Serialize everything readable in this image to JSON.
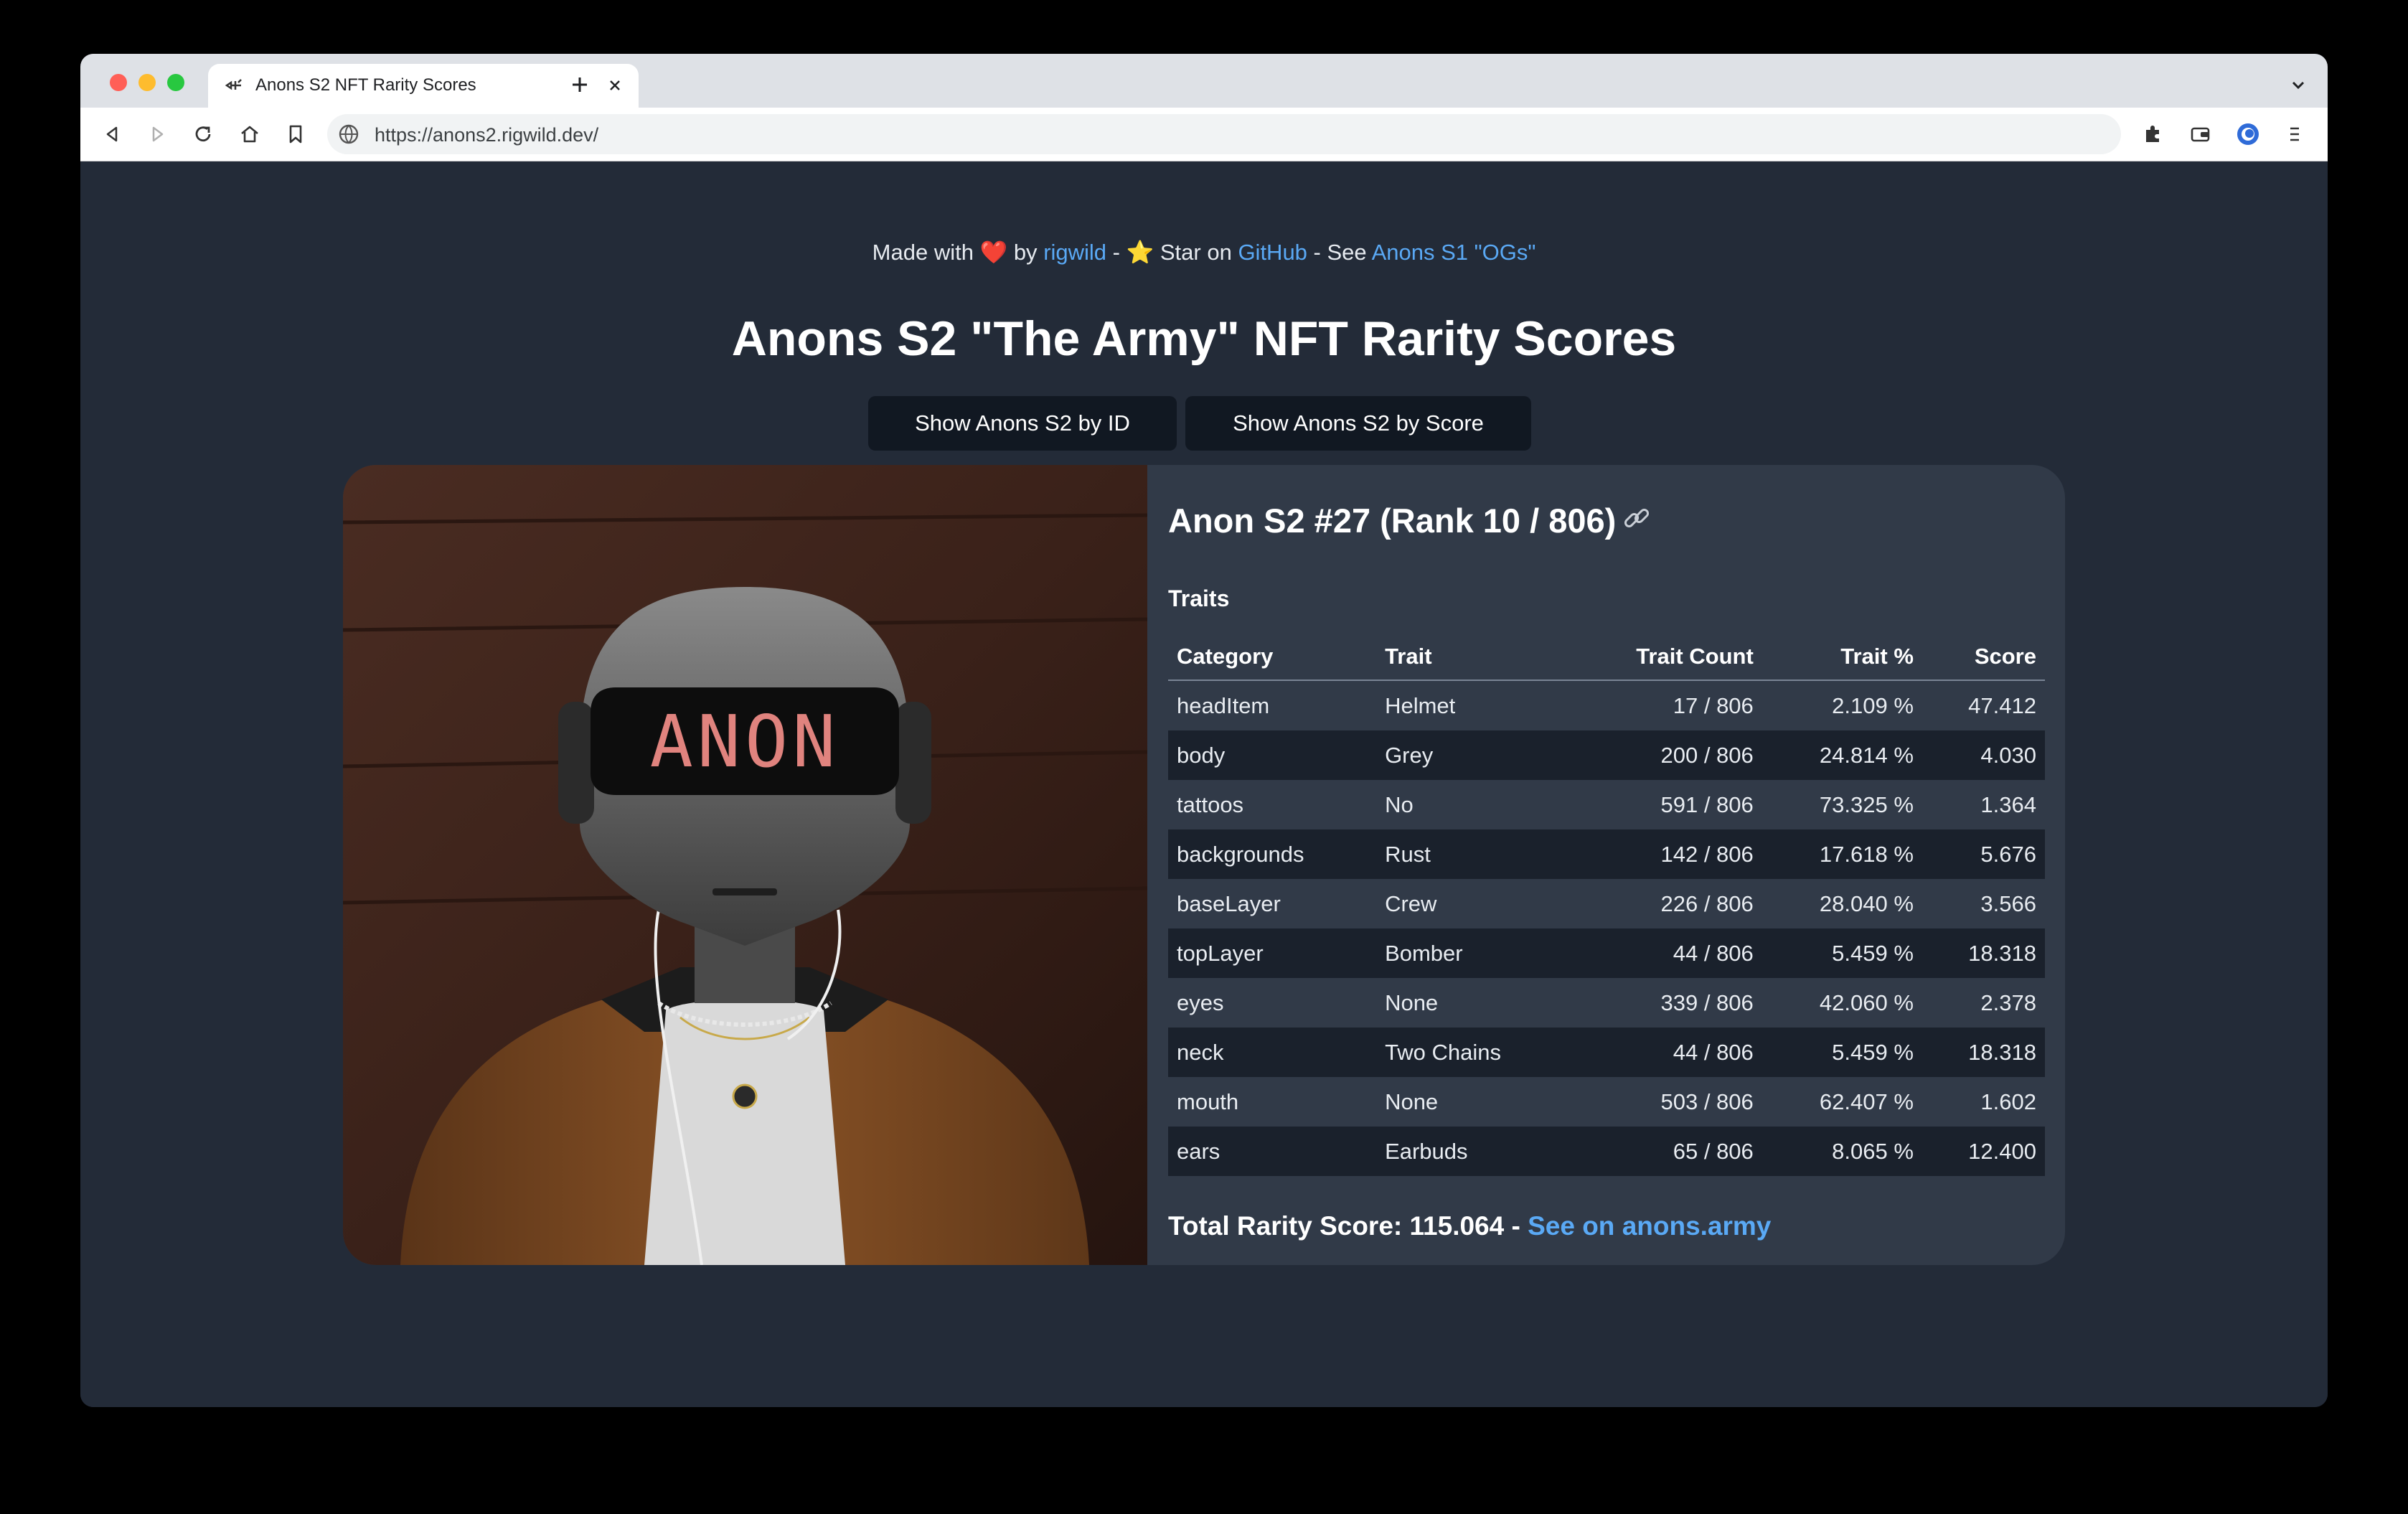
{
  "browser": {
    "tab_title": "Anons S2 NFT Rarity Scores",
    "url": "https://anons2.rigwild.dev/"
  },
  "credit": {
    "made_with": "Made with",
    "heart": "❤️",
    "by": "by",
    "author": "rigwild",
    "sep1": "-",
    "star": "⭐",
    "star_on": "Star on",
    "github": "GitHub",
    "sep2": "- See",
    "s1_link": "Anons S1 \"OGs\""
  },
  "page_title": "Anons S2 \"The Army\" NFT Rarity Scores",
  "buttons": {
    "by_id": "Show Anons S2 by ID",
    "by_score": "Show Anons S2 by Score"
  },
  "card": {
    "heading": "Anon S2 #27 (Rank 10 / 806)",
    "visor_text": "ANON",
    "traits_label": "Traits",
    "columns": [
      "Category",
      "Trait",
      "Trait Count",
      "Trait %",
      "Score"
    ],
    "rows": [
      [
        "headItem",
        "Helmet",
        "17 / 806",
        "2.109 %",
        "47.412"
      ],
      [
        "body",
        "Grey",
        "200 / 806",
        "24.814 %",
        "4.030"
      ],
      [
        "tattoos",
        "No",
        "591 / 806",
        "73.325 %",
        "1.364"
      ],
      [
        "backgrounds",
        "Rust",
        "142 / 806",
        "17.618 %",
        "5.676"
      ],
      [
        "baseLayer",
        "Crew",
        "226 / 806",
        "28.040 %",
        "3.566"
      ],
      [
        "topLayer",
        "Bomber",
        "44 / 806",
        "5.459 %",
        "18.318"
      ],
      [
        "eyes",
        "None",
        "339 / 806",
        "42.060 %",
        "2.378"
      ],
      [
        "neck",
        "Two Chains",
        "44 / 806",
        "5.459 %",
        "18.318"
      ],
      [
        "mouth",
        "None",
        "503 / 806",
        "62.407 %",
        "1.602"
      ],
      [
        "ears",
        "Earbuds",
        "65 / 806",
        "8.065 %",
        "12.400"
      ]
    ],
    "total_label": "Total Rarity Score: 115.064 -",
    "total_link": "See on anons.army"
  },
  "colors": {
    "page_bg": "#232b38",
    "card_bg": "#313a48",
    "link": "#5aa9f5",
    "button_bg": "#111822"
  }
}
